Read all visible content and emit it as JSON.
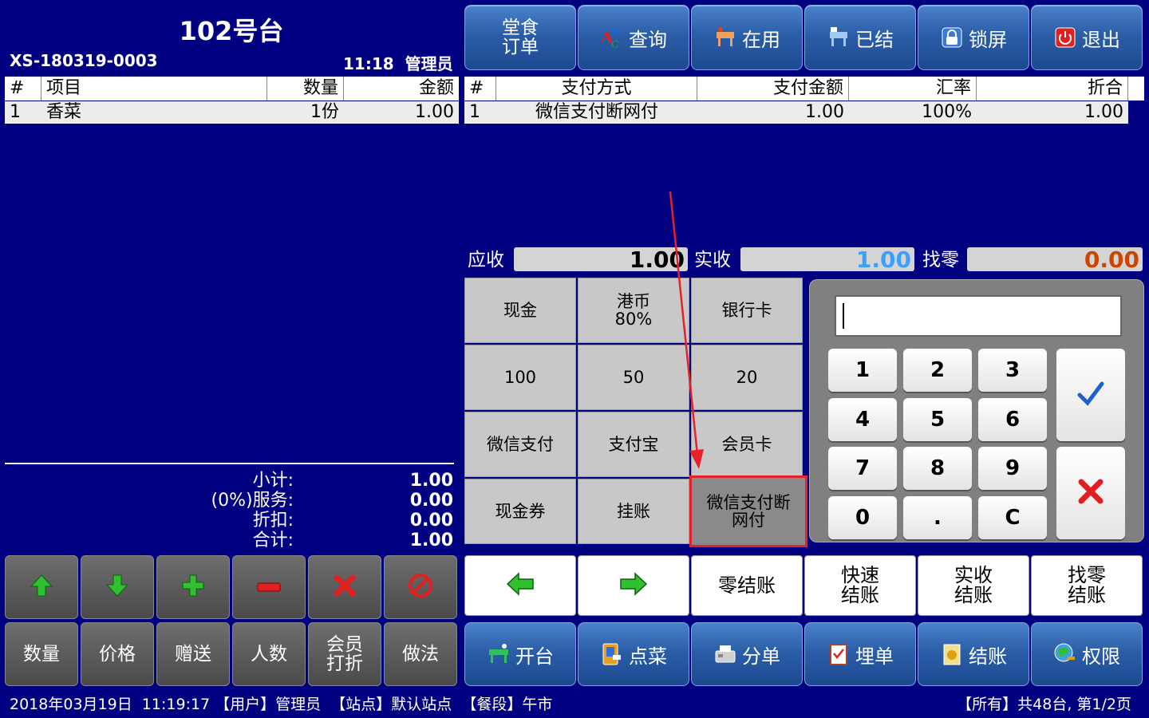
{
  "header": {
    "table_title": "102号台",
    "order_no": "XS-180319-0003",
    "time": "11:18",
    "user": "管理员"
  },
  "nav": [
    {
      "label": "堂食\n订单",
      "icon": ""
    },
    {
      "label": "查询",
      "icon": "abc-search-icon"
    },
    {
      "label": "在用",
      "icon": "table-in-use-icon"
    },
    {
      "label": "已结",
      "icon": "table-settled-icon"
    },
    {
      "label": "锁屏",
      "icon": "lock-icon"
    },
    {
      "label": "退出",
      "icon": "power-icon"
    }
  ],
  "items_table": {
    "headers": [
      "#",
      "项目",
      "数量",
      "金额"
    ],
    "rows": [
      [
        "1",
        "香菜",
        "1份",
        "1.00"
      ]
    ]
  },
  "pay_table": {
    "headers": [
      "#",
      "支付方式",
      "支付金额",
      "汇率",
      "折合"
    ],
    "rows": [
      [
        "1",
        "微信支付断网付",
        "1.00",
        "100%",
        "1.00"
      ]
    ]
  },
  "summary": {
    "subtotal_label": "小计:",
    "subtotal": "1.00",
    "service_label": "(0%)服务:",
    "service": "0.00",
    "discount_label": "折扣:",
    "discount": "0.00",
    "total_label": "合计:",
    "total": "1.00"
  },
  "amounts": {
    "due_label": "应收",
    "due": "1.00",
    "received_label": "实收",
    "received": "1.00",
    "change_label": "找零",
    "change": "0.00",
    "colors": {
      "due": "#000000",
      "received": "#3aa0ff",
      "change": "#cc4400"
    }
  },
  "payment_methods": [
    "现金",
    "港币\n80%",
    "银行卡",
    "100",
    "50",
    "20",
    "微信支付",
    "支付宝",
    "会员卡",
    "现金券",
    "挂账",
    "微信支付断\n网付"
  ],
  "selected_payment": "微信支付断\n网付",
  "keypad": {
    "keys": [
      "1",
      "2",
      "3",
      "4",
      "5",
      "6",
      "7",
      "8",
      "9",
      "0",
      ".",
      "C"
    ],
    "confirm": "checkmark-icon",
    "cancel": "x-icon",
    "input_value": ""
  },
  "actions": [
    "",
    "",
    "零结账",
    "快速\n结账",
    "实收\n结账",
    "找零\n结账"
  ],
  "left_icons": [
    "up-arrow-icon",
    "down-arrow-icon",
    "plus-icon",
    "minus-icon",
    "delete-icon",
    "cancel-icon"
  ],
  "left_buttons": [
    "数量",
    "价格",
    "赠送",
    "人数",
    "会员\n打折",
    "做法"
  ],
  "bottom_nav": [
    {
      "label": "开台",
      "icon": "open-table-icon"
    },
    {
      "label": "点菜",
      "icon": "order-icon"
    },
    {
      "label": "分单",
      "icon": "split-icon"
    },
    {
      "label": "埋单",
      "icon": "bill-icon"
    },
    {
      "label": "结账",
      "icon": "checkout-icon"
    },
    {
      "label": "权限",
      "icon": "permission-icon"
    }
  ],
  "status": {
    "left": "2018年03月19日  11:19:17 【用户】管理员  【站点】默认站点  【餐段】午市",
    "right": "【所有】共48台, 第1/2页"
  }
}
